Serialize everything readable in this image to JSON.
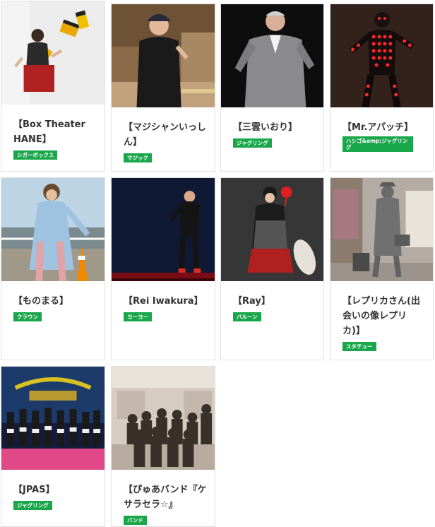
{
  "performers": [
    {
      "name": "【Box Theater HANE】",
      "category": "シガーボックス"
    },
    {
      "name": "【マジシャンいっしん】",
      "category": "マジック"
    },
    {
      "name": "【三雲いおり】",
      "category": "ジャグリング"
    },
    {
      "name": "【Mr.アパッチ】",
      "category": "ハシゴ&amp;ジャグリング"
    },
    {
      "name": "【ものまる】",
      "category": "クラウン"
    },
    {
      "name": "【Rei Iwakura】",
      "category": "ヨーヨー"
    },
    {
      "name": "【Ray】",
      "category": "バルーン"
    },
    {
      "name": "【レプリカさん(出会いの像レプリカ)】",
      "category": "スタチュー"
    },
    {
      "name": "【JPAS】",
      "category": "ジャグリング"
    },
    {
      "name": "【ぴゅあバンド『ケサラセラ☆』",
      "category": "バンド"
    }
  ],
  "colors": {
    "badge": "#1aa64a",
    "title": "#333333",
    "border": "#e2e2e2"
  }
}
